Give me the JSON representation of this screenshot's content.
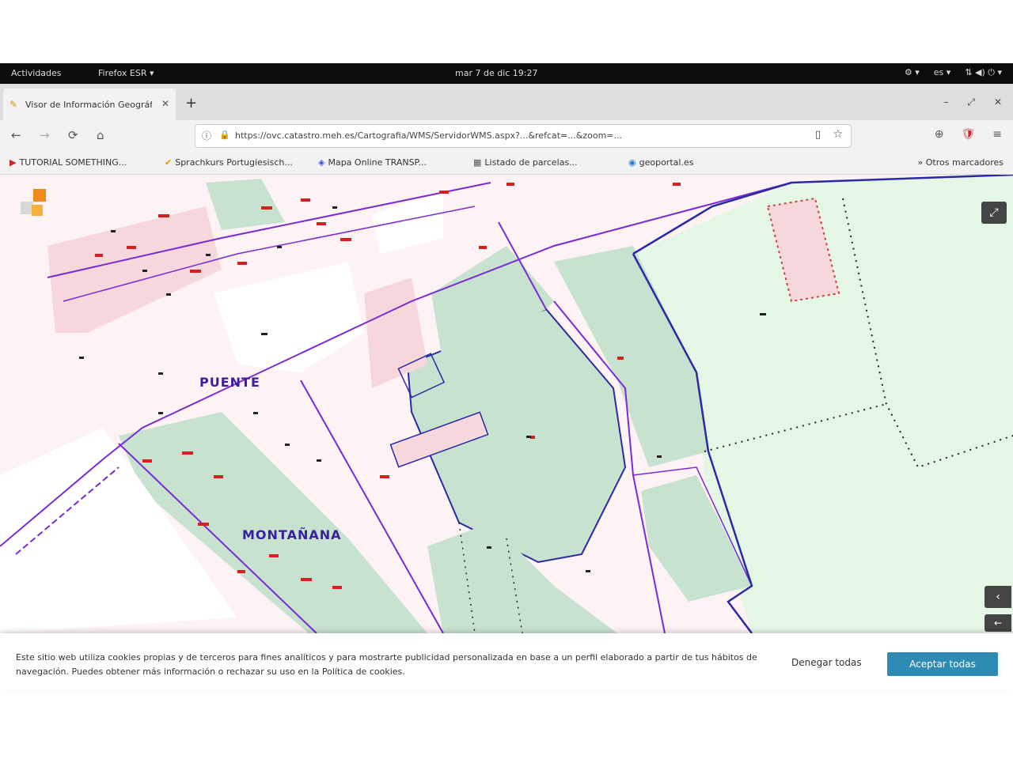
{
  "system_bar": {
    "activities": "Actividades",
    "app_menu": "Firefox ESR ▾",
    "clock": "mar 7 de dic 19:27",
    "tray": [
      "⚙ ▾",
      "es ▾",
      "⇅ ◀) ⏻ ▾"
    ]
  },
  "browser": {
    "tab_title": "Visor de Información Geográfica",
    "tab_close": "✕",
    "new_tab": "+",
    "window_controls": [
      "–",
      "⤢",
      "✕"
    ],
    "nav": {
      "back": "←",
      "forward": "→",
      "reload": "⟳",
      "home": "⌂"
    },
    "url": "https://ovc.catastro.meh.es/Cartografia/WMS/ServidorWMS.aspx?...&refcat=...&zoom=...",
    "url_icons": {
      "info": "ⓘ",
      "lock": "🔒",
      "reader": "▯",
      "star": "☆"
    },
    "toolbar_right": [
      "⊕",
      "🛡",
      "≡"
    ],
    "bookmarks": [
      {
        "icon": "▶",
        "label": "TUTORIAL SOMETHING...",
        "color": "#d62020"
      },
      {
        "icon": "✔",
        "label": "Sprachkurs Portugiesisch...",
        "color": "#d89a00"
      },
      {
        "icon": "◈",
        "label": "Mapa Online TRANSP...",
        "color": "#3a5ad6"
      },
      {
        "icon": "▦",
        "label": "Listado de parcelas...",
        "color": "#555555"
      },
      {
        "icon": "◉",
        "label": "geoportal.es",
        "color": "#2a7ad6"
      }
    ],
    "bookmarks_other": "» Otros marcadores"
  },
  "map": {
    "labels": {
      "puente": "PUENTE",
      "montanana": "MONTAÑANA"
    },
    "colors": {
      "urban_parcel": "#f6d7dc",
      "rustic_parcel": "#c8e2d0",
      "boundary": "#7a2ad6",
      "main_border": "#2a2aa6",
      "field": "#e4f6e4"
    }
  },
  "cookie_banner": {
    "text": "Este sitio web utiliza cookies propias y de terceros para fines analíticos y para mostrarte publicidad personalizada en base a un perfil elaborado a partir de tus hábitos de navegación. Puedes obtener más información o rechazar su uso en la Política de cookies.",
    "deny_label": "Denegar todas",
    "accept_label": "Aceptar todas"
  }
}
